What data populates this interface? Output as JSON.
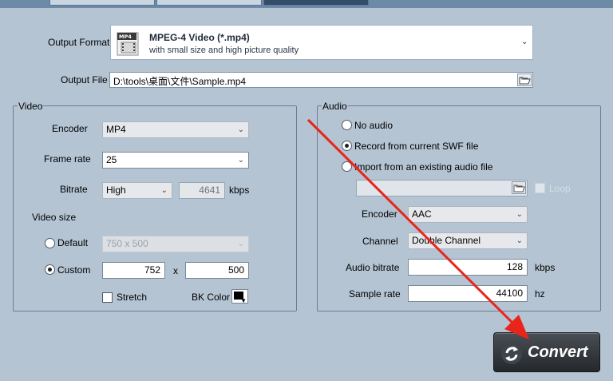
{
  "colors": {
    "background": "#b4c4d3",
    "accent_arrow": "#e8251b",
    "convert_button": "#2d3136"
  },
  "output": {
    "format_label": "Output Format",
    "format_icon_text": "MP4",
    "format_title": "MPEG-4 Video (*.mp4)",
    "format_desc": "with small size and high picture quality",
    "file_label": "Output File",
    "file_value": "D:\\tools\\桌面\\文件\\Sample.mp4"
  },
  "video": {
    "group_title": "Video",
    "encoder_label": "Encoder",
    "encoder_value": "MP4",
    "framerate_label": "Frame rate",
    "framerate_value": "25",
    "bitrate_label": "Bitrate",
    "bitrate_value": "High",
    "bitrate_number": "4641",
    "bitrate_unit": "kbps",
    "size_label": "Video size",
    "default_label": "Default",
    "default_value": "750 x 500",
    "custom_label": "Custom",
    "width_value": "752",
    "x_sep": "x",
    "height_value": "500",
    "stretch_label": "Stretch",
    "bkcolor_label": "BK Color"
  },
  "audio": {
    "group_title": "Audio",
    "no_audio_label": "No audio",
    "record_label": "Record from current SWF file",
    "import_label": "Import from an existing audio file",
    "audio_file_value": "",
    "loop_label": "Loop",
    "encoder_label": "Encoder",
    "encoder_value": "AAC",
    "channel_label": "Channel",
    "channel_value": "Double Channel",
    "bitrate_label": "Audio bitrate",
    "bitrate_value": "128",
    "bitrate_unit": "kbps",
    "samplerate_label": "Sample rate",
    "samplerate_value": "44100",
    "samplerate_unit": "hz"
  },
  "convert": {
    "label": "Convert",
    "icon": "refresh-icon"
  }
}
